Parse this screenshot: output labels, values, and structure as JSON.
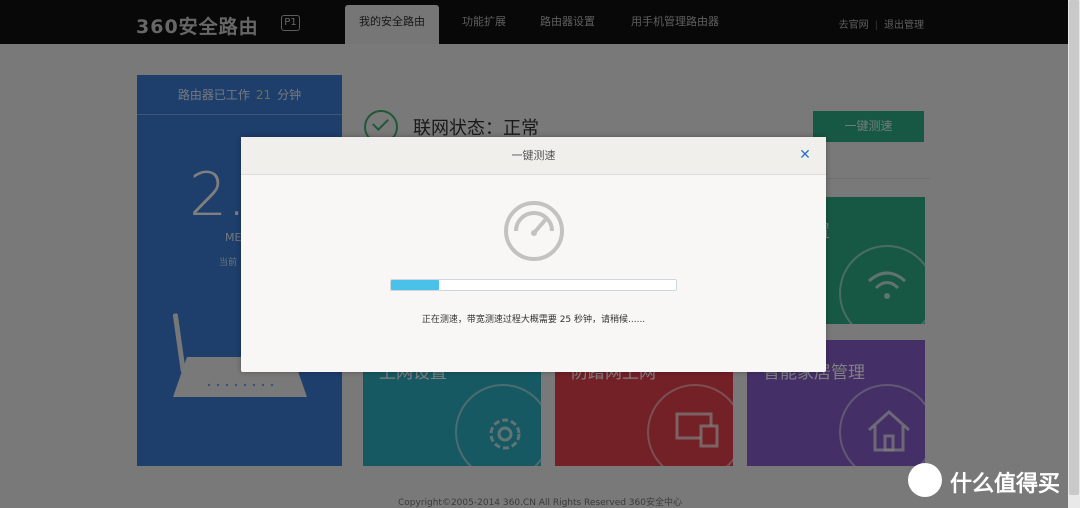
{
  "header": {
    "logo_text": "360安全路由",
    "model": "P1",
    "tabs": [
      {
        "label": "我的安全路由",
        "active": true
      },
      {
        "label": "功能扩展",
        "active": false
      },
      {
        "label": "路由器设置",
        "active": false
      },
      {
        "label": "用手机管理路由器",
        "active": false
      }
    ],
    "links": [
      "去官网",
      "退出管理"
    ]
  },
  "left_panel": {
    "uptime_prefix": "路由器已工作",
    "uptime_value": "21",
    "uptime_unit": "分钟",
    "speed_value": "2.",
    "speed_unit": "ME",
    "speed_note": "当前"
  },
  "status": {
    "text": "联网状态：正常",
    "speedtest_button": "一键测速"
  },
  "tiles": [
    {
      "label": "置",
      "color": "#2eb088"
    },
    {
      "label": "上网设置",
      "color": "#2fb3c4"
    },
    {
      "label": "防蹭网上网",
      "color": "#e8404f"
    },
    {
      "label": "智能家居管理",
      "color": "#8a5fcf"
    }
  ],
  "modal": {
    "title": "一键测速",
    "progress": 0.17,
    "message": "正在测速，带宽测速过程大概需要 25 秒钟，请稍候......"
  },
  "footer": {
    "copyright": "Copyright©2005-2014 360.CN All Rights Reserved 360安全中心"
  },
  "watermark": {
    "text": "什么值得买"
  }
}
